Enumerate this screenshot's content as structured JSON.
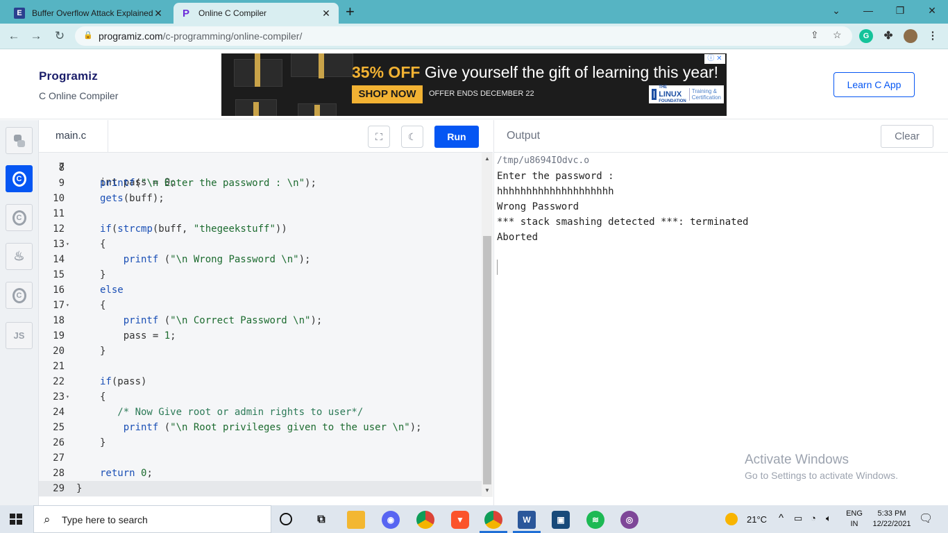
{
  "browser": {
    "tabs": [
      {
        "title": "Buffer Overflow Attack Explained",
        "favicon": "E"
      },
      {
        "title": "Online C Compiler",
        "favicon": "P"
      }
    ],
    "url_host": "programiz.com",
    "url_path": "/c-programming/online-compiler/",
    "new_tab": "+",
    "profile_ext": "G"
  },
  "site": {
    "logo": "Programiz",
    "subtitle": "C Online Compiler",
    "learn_button": "Learn C App"
  },
  "ad": {
    "percent": "35% OFF",
    "headline": "Give yourself the gift of learning this year!",
    "cta": "SHOP NOW",
    "offer": "OFFER ENDS DECEMBER 22",
    "brand_top": "THE",
    "brand_name": "LINUX",
    "brand_bottom": "FOUNDATION",
    "brand_tag_1": "Training &",
    "brand_tag_2": "Certification"
  },
  "rail": [
    {
      "icon": "python-icon",
      "label": ""
    },
    {
      "icon": "c-icon",
      "label": "C"
    },
    {
      "icon": "cpp-icon",
      "label": "C"
    },
    {
      "icon": "java-icon",
      "label": ""
    },
    {
      "icon": "csharp-icon",
      "label": "C"
    },
    {
      "icon": "js-icon",
      "label": "JS"
    }
  ],
  "editor": {
    "file_name": "main.c",
    "run_label": "Run",
    "line_7_partial": "int pass = 0;",
    "lines": [
      {
        "no": "8",
        "text": ""
      },
      {
        "no": "9",
        "text": "printf(\"\\n Enter the password : \\n\");"
      },
      {
        "no": "10",
        "text": "gets(buff);"
      },
      {
        "no": "11",
        "text": ""
      },
      {
        "no": "12",
        "text": "if(strcmp(buff, \"thegeekstuff\"))"
      },
      {
        "no": "13",
        "text": "{"
      },
      {
        "no": "14",
        "text": "    printf (\"\\n Wrong Password \\n\");"
      },
      {
        "no": "15",
        "text": "}"
      },
      {
        "no": "16",
        "text": "else"
      },
      {
        "no": "17",
        "text": "{"
      },
      {
        "no": "18",
        "text": "    printf (\"\\n Correct Password \\n\");"
      },
      {
        "no": "19",
        "text": "    pass = 1;"
      },
      {
        "no": "20",
        "text": "}"
      },
      {
        "no": "21",
        "text": ""
      },
      {
        "no": "22",
        "text": "if(pass)"
      },
      {
        "no": "23",
        "text": "{"
      },
      {
        "no": "24",
        "text": "   /* Now Give root or admin rights to user*/"
      },
      {
        "no": "25",
        "text": "    printf (\"\\n Root privileges given to the user \\n\");"
      },
      {
        "no": "26",
        "text": "}"
      },
      {
        "no": "27",
        "text": ""
      },
      {
        "no": "28",
        "text": "return 0;"
      },
      {
        "no": "29",
        "text": "}"
      }
    ]
  },
  "output": {
    "title": "Output",
    "clear_label": "Clear",
    "lines": [
      "/tmp/u8694IOdvc.o",
      "Enter the password :",
      "hhhhhhhhhhhhhhhhhhhh",
      "Wrong Password",
      "*** stack smashing detected ***: terminated",
      "Aborted"
    ]
  },
  "watermark": {
    "line1": "Activate Windows",
    "line2": "Go to Settings to activate Windows."
  },
  "taskbar": {
    "search_placeholder": "Type here to search",
    "temperature": "21°C",
    "lang_1": "ENG",
    "lang_2": "IN",
    "time": "5:33 PM",
    "date": "12/22/2021"
  },
  "colors": {
    "accent": "#0556f3",
    "tabstrip": "#56b4c3",
    "toolbar": "#d9eef1",
    "keyword": "#1a4fb5",
    "string": "#1c6b2f",
    "ad_gold": "#f2b233"
  }
}
